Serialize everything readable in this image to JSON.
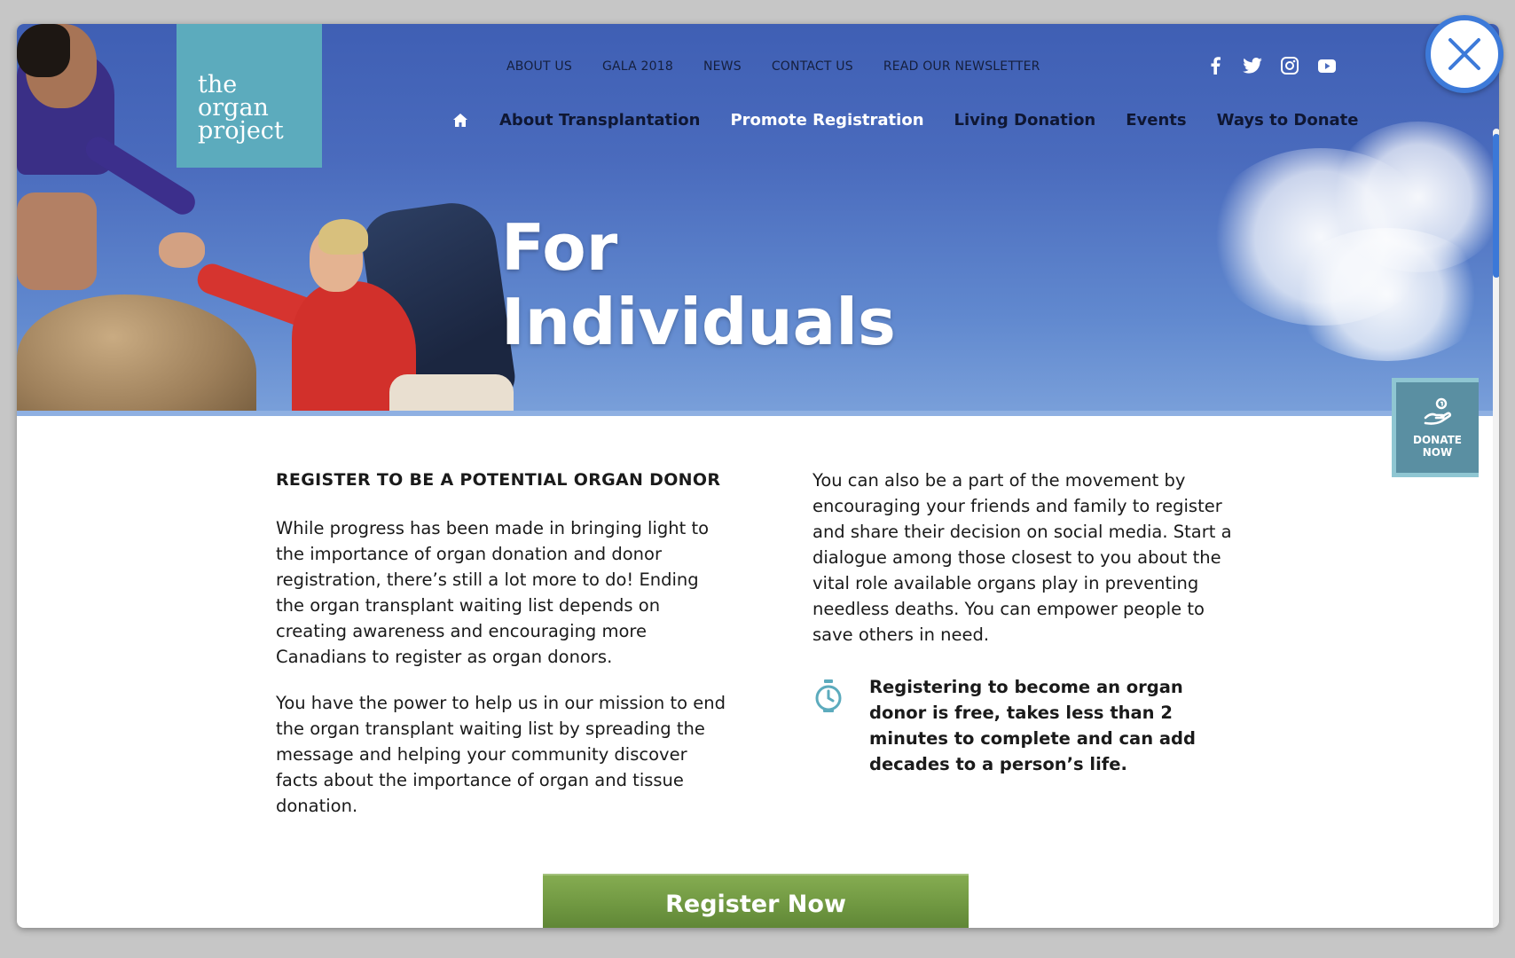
{
  "site": {
    "logo_lines": [
      "the",
      "organ",
      "project"
    ]
  },
  "topnav": {
    "items": [
      "ABOUT US",
      "GALA 2018",
      "NEWS",
      "CONTACT US",
      "READ OUR NEWSLETTER"
    ]
  },
  "social": {
    "icons": [
      "facebook-icon",
      "twitter-icon",
      "instagram-icon",
      "youtube-icon"
    ]
  },
  "mainnav": {
    "home_icon": "home-icon",
    "items": [
      "About Transplantation",
      "Promote Registration",
      "Living Donation",
      "Events",
      "Ways to Donate"
    ],
    "active_index": 1
  },
  "hero": {
    "title_line1": "For",
    "title_line2": "Individuals"
  },
  "donate_tab": {
    "line1": "DONATE",
    "line2": "NOW",
    "icon": "donate-hand-coin-icon"
  },
  "content": {
    "heading": "REGISTER TO BE A POTENTIAL ORGAN DONOR",
    "left_paragraphs": [
      "While progress has been made in bringing light to the importance of organ donation and donor registration, there’s still a lot more to do! Ending the organ transplant waiting list depends on creating awareness and encouraging more Canadians to register as organ donors.",
      "You have the power to help us in our mission to end the organ transplant waiting list by spreading the message and helping your community discover facts about the importance of organ and tissue donation."
    ],
    "right_paragraph": "You can also be a part of the movement by encouraging your friends and family to register and share their decision on social media. Start a dialogue among those closest to you about the vital role available organs play in preventing needless deaths. You can empower people to save others in need.",
    "callout_icon": "stopwatch-icon",
    "callout_text": "Registering to become an organ donor is free, takes less than 2 minutes to complete and can add decades to a person’s life."
  },
  "cta": {
    "register_label": "Register Now"
  },
  "modal": {
    "close_icon": "close-icon"
  },
  "colors": {
    "accent_blue": "#3d7ad9",
    "logo_teal": "#5cabbd",
    "cta_green": "#6e9640",
    "nav_text": "#0f1733"
  }
}
